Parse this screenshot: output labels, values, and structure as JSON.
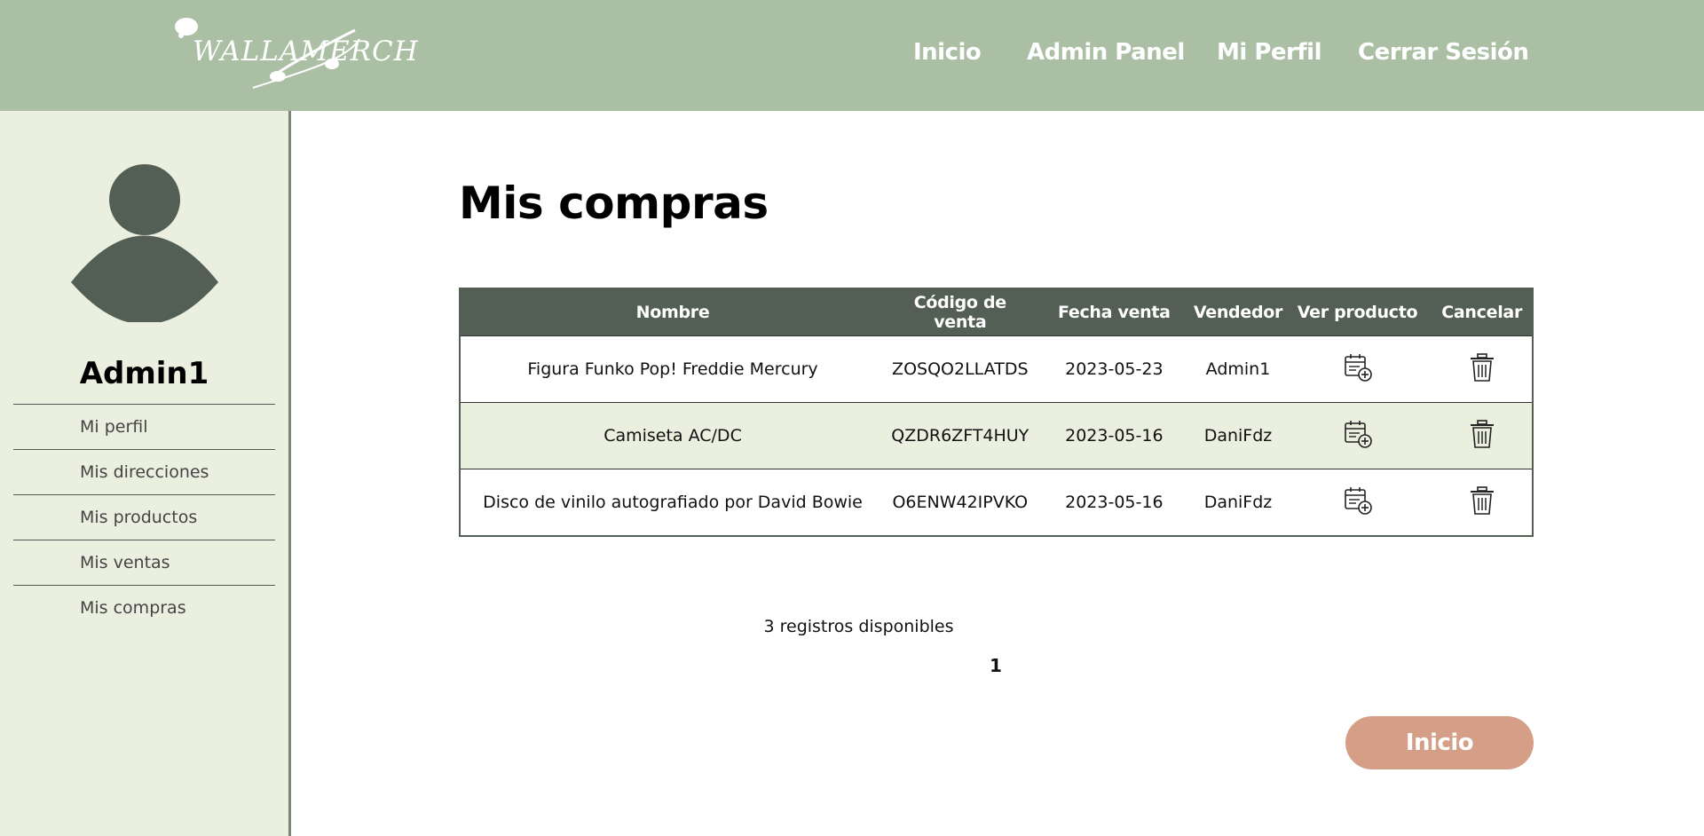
{
  "header": {
    "logo_text": "WALLAMERCH",
    "nav": [
      "Inicio",
      "Admin Panel",
      "Mi Perfil",
      "Cerrar Sesión"
    ]
  },
  "sidebar": {
    "avatar_icon": "user-silhouette-icon",
    "username": "Admin1",
    "items": [
      {
        "label": "Mi perfil"
      },
      {
        "label": "Mis direcciones"
      },
      {
        "label": "Mis productos"
      },
      {
        "label": "Mis ventas"
      },
      {
        "label": "Mis compras"
      }
    ]
  },
  "main": {
    "title": "Mis compras",
    "table": {
      "columns": [
        "Nombre",
        "Código de venta",
        "Fecha venta",
        "Vendedor",
        "Ver producto",
        "Cancelar"
      ],
      "rows": [
        {
          "nombre": "Figura Funko Pop! Freddie Mercury",
          "codigo": "ZOSQO2LLATDS",
          "fecha": "2023-05-23",
          "vendedor": "Admin1"
        },
        {
          "nombre": "Camiseta AC/DC",
          "codigo": "QZDR6ZFT4HUY",
          "fecha": "2023-05-16",
          "vendedor": "DaniFdz"
        },
        {
          "nombre": "Disco de vinilo autografiado por David Bowie",
          "codigo": "O6ENW42IPVKO",
          "fecha": "2023-05-16",
          "vendedor": "DaniFdz"
        }
      ],
      "view_icon": "calendar-plus-icon",
      "cancel_icon": "trash-icon"
    },
    "records_text": "3 registros disponibles",
    "page": "1",
    "home_button": "Inicio"
  },
  "colors": {
    "header_bg": "#abbfa4",
    "sidebar_bg": "#ebefdf",
    "table_header_bg": "#535e55",
    "accent_button": "#d59e87"
  }
}
